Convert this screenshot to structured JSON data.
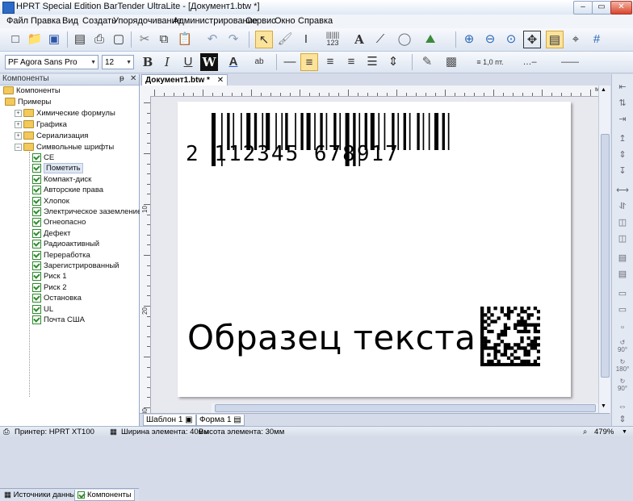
{
  "window": {
    "title": "HPRT Special Edition BarTender UltraLite - [Документ1.btw *]",
    "min": "‒",
    "max": "▭",
    "close": "✕"
  },
  "menu": [
    "Файл",
    "Правка",
    "Вид",
    "Создать",
    "Упорядочивание",
    "Администрирование",
    "Сервис",
    "Окно",
    "Справка"
  ],
  "toolbar2": {
    "font": "PF Agora Sans Pro",
    "size": "12",
    "bold": "B",
    "italic": "I",
    "underline": "U",
    "wordwrap": "W",
    "line_width": "1,0 пт."
  },
  "components_panel": {
    "title": "Компоненты",
    "pin": "ᵽ",
    "close": "✕",
    "tree": {
      "root": "Компоненты",
      "examples": "Примеры",
      "folders": [
        "Химические формулы",
        "Графика",
        "Сериализация",
        "Символьные шрифты"
      ],
      "symbols": [
        "CE",
        "Пометить",
        "Компакт-диск",
        "Авторские права",
        "Хлопок",
        "Электрическое заземление",
        "Огнеопасно",
        "Дефект",
        "Радиоактивный",
        "Переработка",
        "Зарегистрированный",
        "Риск 1",
        "Риск 2",
        "Остановка",
        "UL",
        "Почта США"
      ],
      "selected": "Пометить"
    },
    "tabs": [
      "Источники данных",
      "Компоненты"
    ]
  },
  "document": {
    "tab": "Документ1.btw *",
    "tab_close": "✕",
    "ruler_unit": "мм",
    "ruler_left_marks": [
      "10",
      "20",
      "30"
    ],
    "barcode_digits": "2 112345 678917",
    "sample_text": "Образец текста",
    "bottom_tabs": [
      "Шаблон 1",
      "Форма 1"
    ]
  },
  "status": {
    "printer": "Принтер: HPRT XT100",
    "width": "Ширина элемента: 40мм",
    "height": "Высота элемента: 30мм",
    "zoom": "479%"
  },
  "right_toolbar": {
    "rot90a": "90°",
    "rot180": "180°",
    "rot90b": "90°"
  },
  "colors": {
    "accent_selected": "#fbe39b",
    "label_bg": "#ffffff",
    "workspace": "#e8e9ee"
  }
}
